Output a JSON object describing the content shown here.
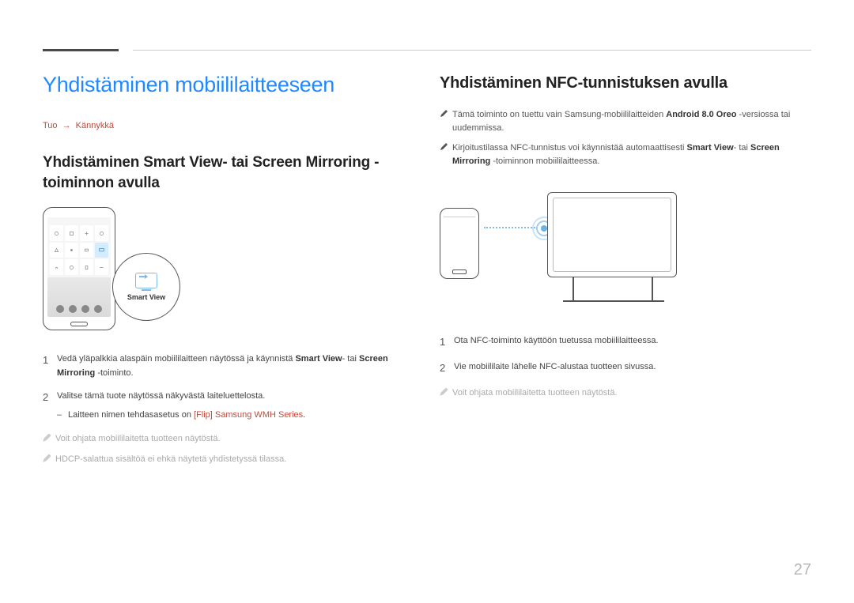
{
  "page_number": "27",
  "left": {
    "main_title": "Yhdistäminen mobiililaitteeseen",
    "breadcrumb_a": "Tuo",
    "breadcrumb_b": "Kännykkä",
    "sub_title": "Yhdistäminen Smart View- tai Screen Mirroring -toiminnon avulla",
    "smart_view_label": "Smart View",
    "step1_a": "Vedä yläpalkkia alaspäin mobiililaitteen näytössä ja käynnistä ",
    "step1_b": "Smart View",
    "step1_c": "- tai ",
    "step1_d": "Screen Mirroring",
    "step1_e": " -toiminto.",
    "step2_a": "Valitse tämä tuote näytössä näkyvästä laiteluettelosta.",
    "step2_sub_a": "Laitteen nimen tehdasasetus on ",
    "step2_sub_b": "[Flip] Samsung WMH Series",
    "step2_sub_c": ".",
    "note1": "Voit ohjata mobiililaitetta tuotteen näytöstä.",
    "note2": "HDCP-salattua sisältöä ei ehkä näytetä yhdistetyssä tilassa."
  },
  "right": {
    "sub_title": "Yhdistäminen NFC-tunnistuksen avulla",
    "note1_a": "Tämä toiminto on tuettu vain Samsung-mobiililaitteiden ",
    "note1_b": "Android 8.0 Oreo",
    "note1_c": " -versiossa tai uudemmissa.",
    "note2_a": "Kirjoitustilassa NFC-tunnistus voi käynnistää automaattisesti ",
    "note2_b": "Smart View",
    "note2_c": "- tai ",
    "note2_d": "Screen Mirroring",
    "note2_e": " -toiminnon mobiililaitteessa.",
    "step1": "Ota NFC-toiminto käyttöön tuetussa mobiililaitteessa.",
    "step2": "Vie mobiililaite lähelle NFC-alustaa tuotteen sivussa.",
    "note3": "Voit ohjata mobiililaitetta tuotteen näytöstä."
  }
}
